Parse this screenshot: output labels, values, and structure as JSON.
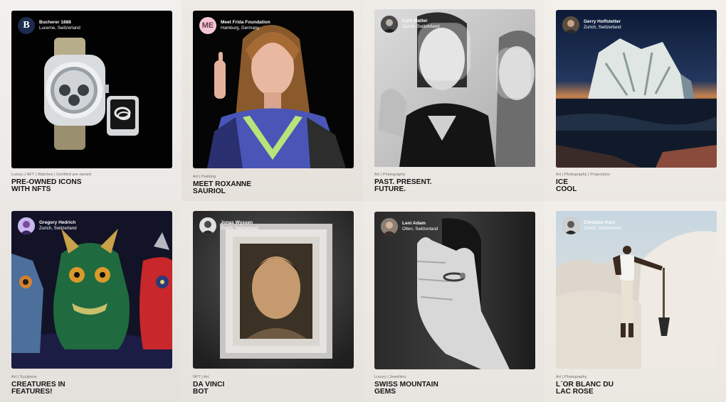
{
  "colors": {
    "page_bg": "#ece8e3",
    "title_text": "#151515",
    "meta_text": "#6f6b66",
    "bucherer_brand": "#1d2b4f",
    "frida_brand": "#f4c6d8"
  },
  "cards": [
    {
      "owner_name": "Bucherer 1888",
      "owner_location": "Lucerne, Switzerland",
      "avatar_monogram": "B",
      "meta": "Luxury | NFT | Watches | Certified pre-owned",
      "title_line1": "PRE-OWNED ICONS",
      "title_line2": "WITH NFTS",
      "image_icon": "luxury-watch-image"
    },
    {
      "owner_name": "Meet Frida Foundation",
      "owner_location": "Hamburg, Germany",
      "avatar_monogram": "ME",
      "meta": "Art | Painting",
      "title_line1": "MEET ROXANNE",
      "title_line2": "SAURIOL",
      "image_icon": "portrait-painting-image"
    },
    {
      "owner_name": "Cyril Matter",
      "owner_location": "Zurich, Switzerland",
      "meta": "Art | Photography",
      "title_line1": "PAST. PRESENT.",
      "title_line2": "FUTURE.",
      "image_icon": "face-shield-photo-image"
    },
    {
      "owner_name": "Gerry Hoffstetter",
      "owner_location": "Zurich, Switzerland",
      "meta": "Art | Photography | Projections",
      "title_line1": "ICE",
      "title_line2": "COOL",
      "image_icon": "iceberg-projection-image"
    },
    {
      "owner_name": "Gregory Hedrich",
      "owner_location": "Zurich, Switzerland",
      "meta": "Art | Sculpture",
      "title_line1": "CREATURES IN",
      "title_line2": "FEATURES!",
      "image_icon": "creature-sculptures-image"
    },
    {
      "owner_name": "Jonas Wyssen",
      "owner_location": "Zurich, Switzerland",
      "meta": "NFT | Art",
      "title_line1": "DA VINCI",
      "title_line2": "BOT",
      "image_icon": "framed-portrait-image"
    },
    {
      "owner_name": "Leni Adam",
      "owner_location": "Olten, Switzerland",
      "meta": "Luxury | Jewellery",
      "title_line1": "SWISS MOUNTAIN",
      "title_line2": "GEMS",
      "image_icon": "hand-ring-image"
    },
    {
      "owner_name": "Christian Kurz",
      "owner_location": "Zurich, Switzerland",
      "meta": "Art | Photography",
      "title_line1": "L´OR BLANC DU",
      "title_line2": "LAC ROSE",
      "image_icon": "salt-mountain-image"
    }
  ]
}
